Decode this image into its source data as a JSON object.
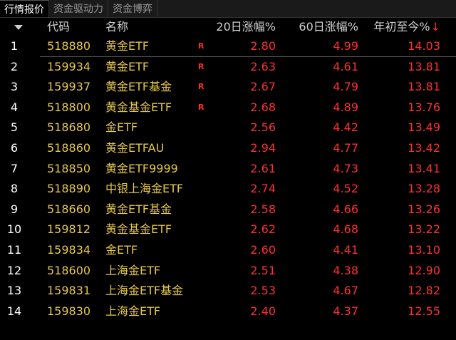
{
  "tabs": [
    {
      "label": "行情报价",
      "active": true
    },
    {
      "label": "资金驱动力",
      "active": false
    },
    {
      "label": "资金博弈",
      "active": false
    }
  ],
  "columns": {
    "code": "代码",
    "name": "名称",
    "v20": "20日涨幅%",
    "v60": "60日涨幅%",
    "ytd": "年初至今%",
    "sort_indicator": "↓"
  },
  "rows": [
    {
      "idx": "1",
      "code": "518880",
      "name": "黄金ETF",
      "badge": "R",
      "v20": "2.80",
      "v60": "4.99",
      "ytd": "14.03"
    },
    {
      "idx": "2",
      "code": "159934",
      "name": "黄金ETF",
      "badge": "R",
      "v20": "2.63",
      "v60": "4.61",
      "ytd": "13.81"
    },
    {
      "idx": "3",
      "code": "159937",
      "name": "黄金ETF基金",
      "badge": "R",
      "v20": "2.67",
      "v60": "4.79",
      "ytd": "13.81"
    },
    {
      "idx": "4",
      "code": "518800",
      "name": "黄金基金ETF",
      "badge": "R",
      "v20": "2.68",
      "v60": "4.89",
      "ytd": "13.76"
    },
    {
      "idx": "5",
      "code": "518680",
      "name": "金ETF",
      "badge": "",
      "v20": "2.56",
      "v60": "4.42",
      "ytd": "13.49"
    },
    {
      "idx": "6",
      "code": "518860",
      "name": "黄金ETFAU",
      "badge": "",
      "v20": "2.94",
      "v60": "4.77",
      "ytd": "13.42"
    },
    {
      "idx": "7",
      "code": "518850",
      "name": "黄金ETF9999",
      "badge": "",
      "v20": "2.61",
      "v60": "4.73",
      "ytd": "13.41"
    },
    {
      "idx": "8",
      "code": "518890",
      "name": "中银上海金ETF",
      "badge": "",
      "v20": "2.74",
      "v60": "4.52",
      "ytd": "13.28"
    },
    {
      "idx": "9",
      "code": "518660",
      "name": "黄金ETF基金",
      "badge": "",
      "v20": "2.58",
      "v60": "4.66",
      "ytd": "13.26"
    },
    {
      "idx": "10",
      "code": "159812",
      "name": "黄金基金ETF",
      "badge": "",
      "v20": "2.62",
      "v60": "4.68",
      "ytd": "13.22"
    },
    {
      "idx": "11",
      "code": "159834",
      "name": "金ETF",
      "badge": "",
      "v20": "2.60",
      "v60": "4.41",
      "ytd": "13.10"
    },
    {
      "idx": "12",
      "code": "518600",
      "name": "上海金ETF",
      "badge": "",
      "v20": "2.51",
      "v60": "4.38",
      "ytd": "12.90"
    },
    {
      "idx": "13",
      "code": "159831",
      "name": "上海金ETF基金",
      "badge": "",
      "v20": "2.53",
      "v60": "4.67",
      "ytd": "12.82"
    },
    {
      "idx": "14",
      "code": "159830",
      "name": "上海金ETF",
      "badge": "",
      "v20": "2.40",
      "v60": "4.37",
      "ytd": "12.55"
    }
  ],
  "colors": {
    "up": "#ff3030",
    "code_name": "#e6c84a",
    "header_text": "#d0d0d0",
    "background": "#000000"
  }
}
